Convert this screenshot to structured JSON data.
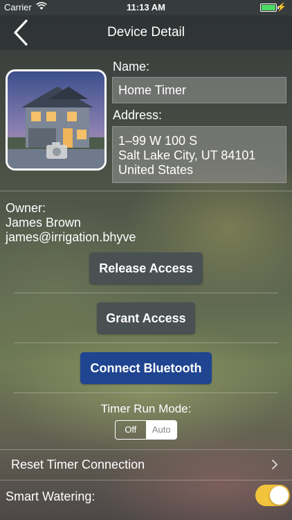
{
  "status_bar": {
    "carrier": "Carrier",
    "time": "11:13 AM"
  },
  "nav": {
    "title": "Device Detail",
    "back_icon": "chevron-left-icon"
  },
  "device": {
    "name_label": "Name:",
    "name_value": "Home Timer",
    "address_label": "Address:",
    "address_lines": [
      "1–99  W 100 S",
      "Salt Lake City, UT 84101",
      "United States"
    ],
    "photo_icon": "camera-icon"
  },
  "owner": {
    "label": "Owner:",
    "name": "James Brown",
    "email": "james@irrigation.bhyve"
  },
  "buttons": {
    "release": "Release Access",
    "grant": "Grant Access",
    "bluetooth": "Connect Bluetooth"
  },
  "run_mode": {
    "label": "Timer Run Mode:",
    "options": [
      "Off",
      "Auto"
    ],
    "selected": "Auto"
  },
  "rows": {
    "reset": "Reset Timer Connection",
    "smart": "Smart Watering:",
    "smart_on": true
  },
  "colors": {
    "accent_blue": "#1f4591",
    "toggle_on": "#f2c33c",
    "battery": "#4cd964"
  }
}
